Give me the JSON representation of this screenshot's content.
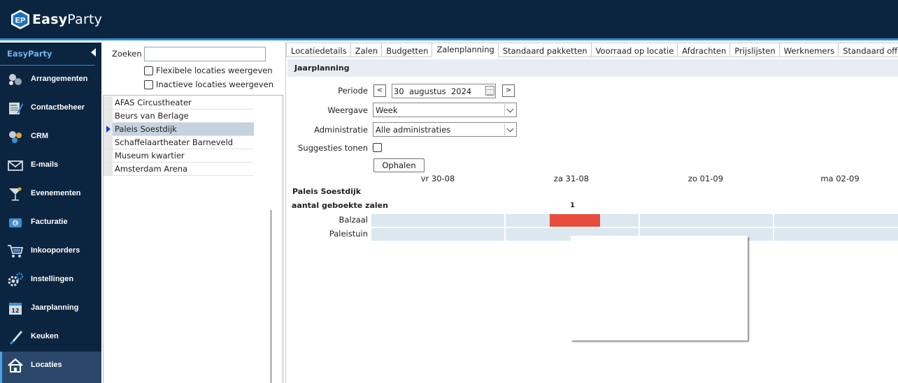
{
  "app": {
    "brand_bold": "Easy",
    "brand_rest": "Party",
    "logo_text": "EP",
    "accent": "#2d8fd5",
    "header_bg": "#0b2541"
  },
  "sidebar": {
    "heading": "EasyParty",
    "items": [
      {
        "label": "Arrangementen",
        "icon": "arrangements-icon"
      },
      {
        "label": "Contactbeheer",
        "icon": "contacts-icon"
      },
      {
        "label": "CRM",
        "icon": "crm-icon"
      },
      {
        "label": "E-mails",
        "icon": "mail-icon"
      },
      {
        "label": "Evenementen",
        "icon": "cocktail-icon"
      },
      {
        "label": "Facturatie",
        "icon": "invoice-icon"
      },
      {
        "label": "Inkooporders",
        "icon": "cart-icon"
      },
      {
        "label": "Instellingen",
        "icon": "gear-icon"
      },
      {
        "label": "Jaarplanning",
        "icon": "calendar-icon"
      },
      {
        "label": "Keuken",
        "icon": "knife-icon"
      },
      {
        "label": "Locaties",
        "icon": "home-icon",
        "active": true
      }
    ]
  },
  "locations": {
    "search_label": "Zoeken",
    "search_value": "",
    "flexible_label": "Flexibele locaties weergeven",
    "inactive_label": "Inactieve locaties weergeven",
    "items": [
      "AFAS Circustheater",
      "Beurs van Berlage",
      "Paleis Soestdijk",
      "Schaffelaartheater Barneveld",
      "Museum kwartier",
      "Amsterdam Arena"
    ],
    "selected": "Paleis Soestdijk"
  },
  "tabs": [
    "Locatiedetails",
    "Zalen",
    "Budgetten",
    "Zalenplanning",
    "Standaard pakketten",
    "Voorraad op locatie",
    "Afdrachten",
    "Prijslijsten",
    "Werknemers",
    "Standaard offertete"
  ],
  "active_tab": "Zalenplanning",
  "planning": {
    "section_title": "Jaarplanning",
    "periode_label": "Periode",
    "prev": "<",
    "next": ">",
    "date_day": "30",
    "date_month": "augustus",
    "date_year": "2024",
    "weergave_label": "Weergave",
    "weergave_value": "Week",
    "administratie_label": "Administratie",
    "administratie_value": "Alle administraties",
    "suggesties_label": "Suggesties tonen",
    "ophalen_label": "Ophalen",
    "days": [
      "vr 30-08",
      "za 31-08",
      "zo 01-09",
      "ma 02-09"
    ],
    "location_title": "Paleis Soestdijk",
    "booked_label": "aantal geboekte zalen",
    "booked_count": "1",
    "rooms": [
      "Balzaal",
      "Paleistuin"
    ],
    "booking_color": "#e84c3d"
  }
}
